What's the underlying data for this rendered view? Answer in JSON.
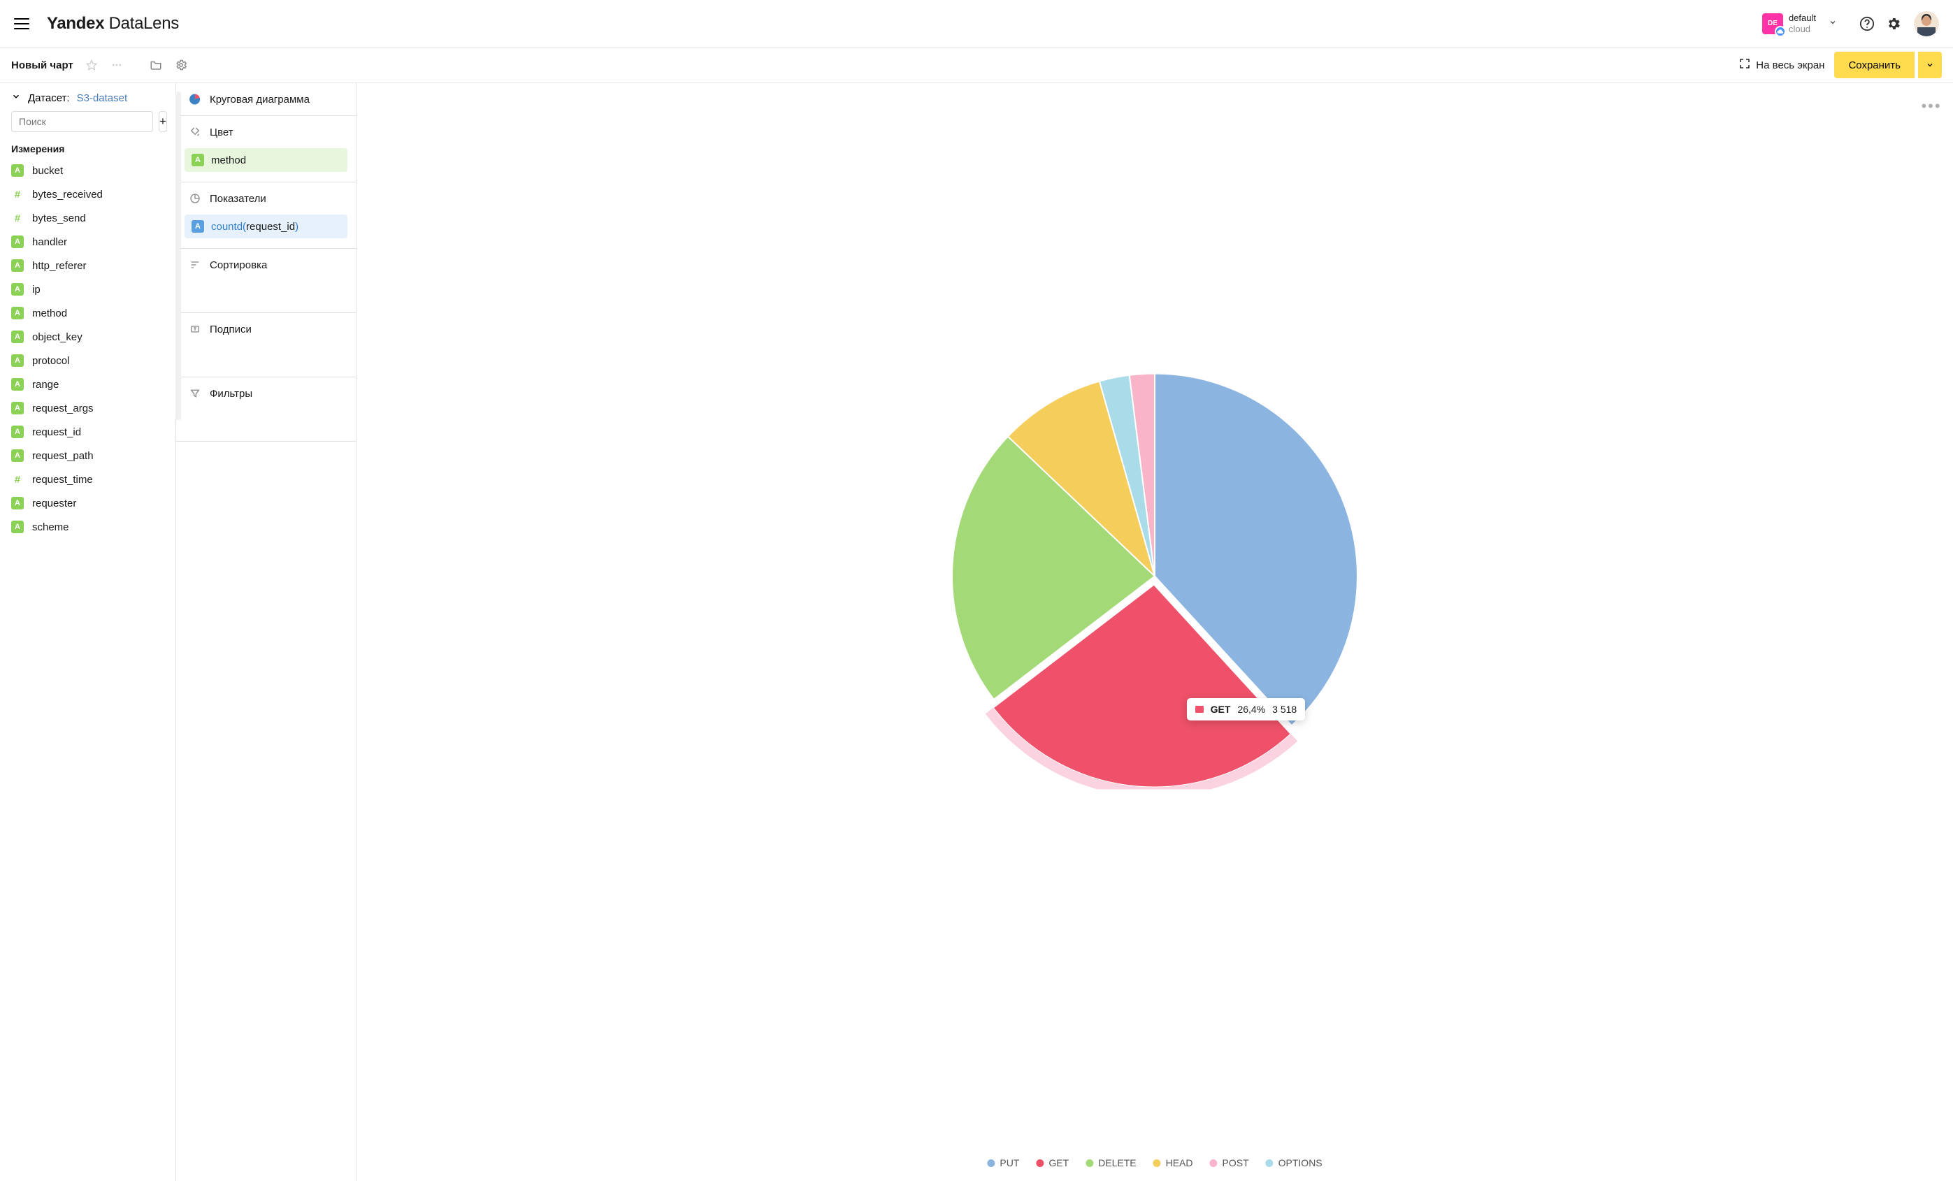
{
  "header": {
    "logo_bold": "Yandex",
    "logo_light": " DataLens",
    "cloud_badge": "DE",
    "cloud_name": "default",
    "cloud_sub": "cloud"
  },
  "subheader": {
    "title": "Новый чарт",
    "fullscreen": "На весь экран",
    "save": "Сохранить"
  },
  "dataset_panel": {
    "label": "Датасет:",
    "name": "S3-dataset",
    "search_placeholder": "Поиск",
    "section_title": "Измерения",
    "fields": [
      {
        "type": "A",
        "name": "bucket"
      },
      {
        "type": "#",
        "name": "bytes_received"
      },
      {
        "type": "#",
        "name": "bytes_send"
      },
      {
        "type": "A",
        "name": "handler"
      },
      {
        "type": "A",
        "name": "http_referer"
      },
      {
        "type": "A",
        "name": "ip"
      },
      {
        "type": "A",
        "name": "method"
      },
      {
        "type": "A",
        "name": "object_key"
      },
      {
        "type": "A",
        "name": "protocol"
      },
      {
        "type": "A",
        "name": "range"
      },
      {
        "type": "A",
        "name": "request_args"
      },
      {
        "type": "A",
        "name": "request_id"
      },
      {
        "type": "A",
        "name": "request_path"
      },
      {
        "type": "#",
        "name": "request_time"
      },
      {
        "type": "A",
        "name": "requester"
      },
      {
        "type": "A",
        "name": "scheme"
      }
    ]
  },
  "config_panel": {
    "chart_type": "Круговая диаграмма",
    "sections": {
      "color": "Цвет",
      "measures": "Показатели",
      "sort": "Сортировка",
      "labels": "Подписи",
      "filters": "Фильтры"
    },
    "color_chip": "method",
    "measure_chip_fn": "countd",
    "measure_chip_arg": "request_id"
  },
  "tooltip": {
    "label": "GET",
    "percent": "26,4%",
    "value": "3 518"
  },
  "legend": [
    {
      "name": "PUT",
      "color": "#8bb5e0"
    },
    {
      "name": "GET",
      "color": "#ee5169"
    },
    {
      "name": "DELETE",
      "color": "#a3d977"
    },
    {
      "name": "HEAD",
      "color": "#f4cd5b"
    },
    {
      "name": "POST",
      "color": "#f9b4c9"
    },
    {
      "name": "OPTIONS",
      "color": "#a9dbe8"
    }
  ],
  "chart_data": {
    "type": "pie",
    "title": "",
    "categories": [
      "PUT",
      "GET",
      "DELETE",
      "HEAD",
      "OPTIONS",
      "POST"
    ],
    "values": [
      5090,
      3518,
      3000,
      1132,
      320,
      266
    ],
    "colors": [
      "#8bb5e0",
      "#ee5169",
      "#a3d977",
      "#f4cd5b",
      "#a9dbe8",
      "#f9b4c9"
    ],
    "highlight": {
      "category": "GET",
      "percent": 26.4,
      "count": 3518
    }
  }
}
